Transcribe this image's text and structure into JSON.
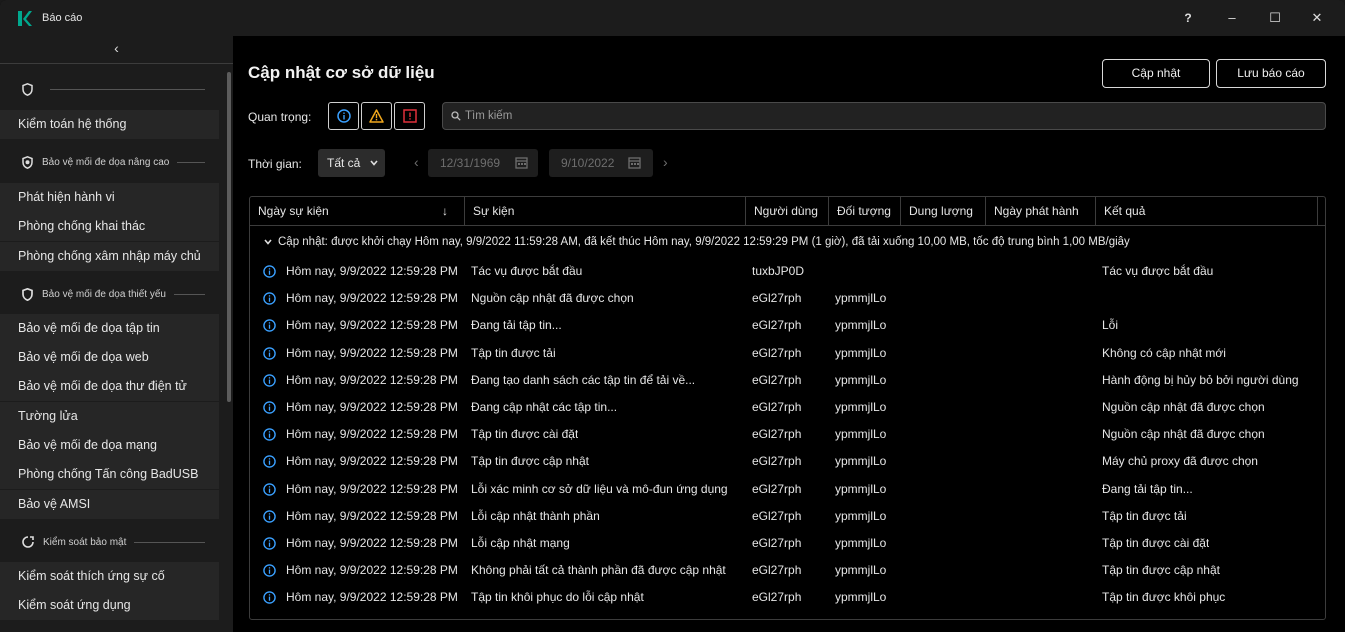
{
  "window": {
    "title": "Báo cáo",
    "help": "?",
    "minimize": "–",
    "maximize": "☐",
    "close": "✕"
  },
  "sidebar": {
    "collapse": "‹",
    "groups": [
      {
        "label": "",
        "icon": "shield-icon",
        "items": [
          "Kiểm toán hệ thống"
        ]
      },
      {
        "label": "Bảo vệ mối đe dọa nâng cao",
        "icon": "shield-filled-icon",
        "items": [
          "Phát hiện hành vi",
          "Phòng chống khai thác",
          "Phòng chống xâm nhập máy chủ"
        ]
      },
      {
        "label": "Bảo vệ mối đe dọa thiết yếu",
        "icon": "shield-outline-icon",
        "items": [
          "Bảo vệ mối đe dọa tập tin",
          "Bảo vệ mối đe dọa web",
          "Bảo vệ mối đe dọa thư điện tử",
          "Tường lửa",
          "Bảo vệ mối đe dọa mạng",
          "Phòng chống Tấn công BadUSB",
          "Bảo vệ AMSI"
        ]
      },
      {
        "label": "Kiểm soát bảo mật",
        "icon": "security-control-icon",
        "items": [
          "Kiểm soát thích ứng sự cố",
          "Kiểm soát ứng dụng"
        ]
      }
    ]
  },
  "main": {
    "title": "Cập nhật cơ sở dữ liệu",
    "update_button": "Cập nhật",
    "save_button": "Lưu báo cáo",
    "severity_label": "Quan trọng:",
    "search_placeholder": "Tìm kiếm",
    "time_label": "Thời gian:",
    "time_select": "Tất cả",
    "date_from": "12/31/1969",
    "date_to": "9/10/2022"
  },
  "table": {
    "columns": [
      "Ngày sự kiện",
      "Sự kiện",
      "Người dùng",
      "Đối tượng",
      "Dung lượng",
      "Ngày phát hành",
      "Kết quả"
    ],
    "group_text": "Cập nhật: được khởi chạy Hôm nay, 9/9/2022 11:59:28 AM, đã kết thúc Hôm nay, 9/9/2022 12:59:29 PM (1 giờ), đã tải xuống 10,00 MB, tốc độ trung bình 1,00 MB/giây",
    "rows": [
      {
        "date": "Hôm nay, 9/9/2022 12:59:28 PM",
        "event": "Tác vụ được bắt đầu",
        "user": "tuxbJP0D",
        "object": "",
        "size": "",
        "release": "",
        "result": "Tác vụ được bắt đầu"
      },
      {
        "date": "Hôm nay, 9/9/2022 12:59:28 PM",
        "event": "Nguồn cập nhật đã được chọn",
        "user": "eGl27rph",
        "object": "ypmmjlLo",
        "size": "",
        "release": "",
        "result": ""
      },
      {
        "date": "Hôm nay, 9/9/2022 12:59:28 PM",
        "event": "Đang tải tập tin...",
        "user": "eGl27rph",
        "object": "ypmmjlLo",
        "size": "",
        "release": "",
        "result": "Lỗi"
      },
      {
        "date": "Hôm nay, 9/9/2022 12:59:28 PM",
        "event": "Tập tin được tải",
        "user": "eGl27rph",
        "object": "ypmmjlLo",
        "size": "",
        "release": "",
        "result": "Không có cập nhật mới"
      },
      {
        "date": "Hôm nay, 9/9/2022 12:59:28 PM",
        "event": "Đang tạo danh sách các tập tin để tải về...",
        "user": "eGl27rph",
        "object": "ypmmjlLo",
        "size": "",
        "release": "",
        "result": "Hành động bị hủy bỏ bởi người dùng"
      },
      {
        "date": "Hôm nay, 9/9/2022 12:59:28 PM",
        "event": "Đang cập nhật các tập tin...",
        "user": "eGl27rph",
        "object": "ypmmjlLo",
        "size": "",
        "release": "",
        "result": "Nguồn cập nhật đã được chọn"
      },
      {
        "date": "Hôm nay, 9/9/2022 12:59:28 PM",
        "event": "Tập tin được cài đặt",
        "user": "eGl27rph",
        "object": "ypmmjlLo",
        "size": "",
        "release": "",
        "result": "Nguồn cập nhật đã được chọn"
      },
      {
        "date": "Hôm nay, 9/9/2022 12:59:28 PM",
        "event": "Tập tin được cập nhật",
        "user": "eGl27rph",
        "object": "ypmmjlLo",
        "size": "",
        "release": "",
        "result": "Máy chủ proxy đã được chọn"
      },
      {
        "date": "Hôm nay, 9/9/2022 12:59:28 PM",
        "event": "Lỗi xác minh cơ sở dữ liệu và mô-đun ứng dụng",
        "user": "eGl27rph",
        "object": "ypmmjlLo",
        "size": "",
        "release": "",
        "result": "Đang tải tập tin..."
      },
      {
        "date": "Hôm nay, 9/9/2022 12:59:28 PM",
        "event": "Lỗi cập nhật thành phần",
        "user": "eGl27rph",
        "object": "ypmmjlLo",
        "size": "",
        "release": "",
        "result": "Tập tin được tải"
      },
      {
        "date": "Hôm nay, 9/9/2022 12:59:28 PM",
        "event": "Lỗi cập nhật mạng",
        "user": "eGl27rph",
        "object": "ypmmjlLo",
        "size": "",
        "release": "",
        "result": "Tập tin được cài đặt"
      },
      {
        "date": "Hôm nay, 9/9/2022 12:59:28 PM",
        "event": "Không phải tất cả thành phần đã được cập nhật",
        "user": "eGl27rph",
        "object": "ypmmjlLo",
        "size": "",
        "release": "",
        "result": "Tập tin được cập nhật"
      },
      {
        "date": "Hôm nay, 9/9/2022 12:59:28 PM",
        "event": "Tập tin khôi phục do lỗi cập nhật",
        "user": "eGl27rph",
        "object": "ypmmjlLo",
        "size": "",
        "release": "",
        "result": "Tập tin được khôi phục"
      }
    ]
  },
  "colors": {
    "accent_green": "#00a88e",
    "info_blue": "#3aa0ff",
    "warning": "#f2a81d",
    "critical": "#e0303a"
  }
}
